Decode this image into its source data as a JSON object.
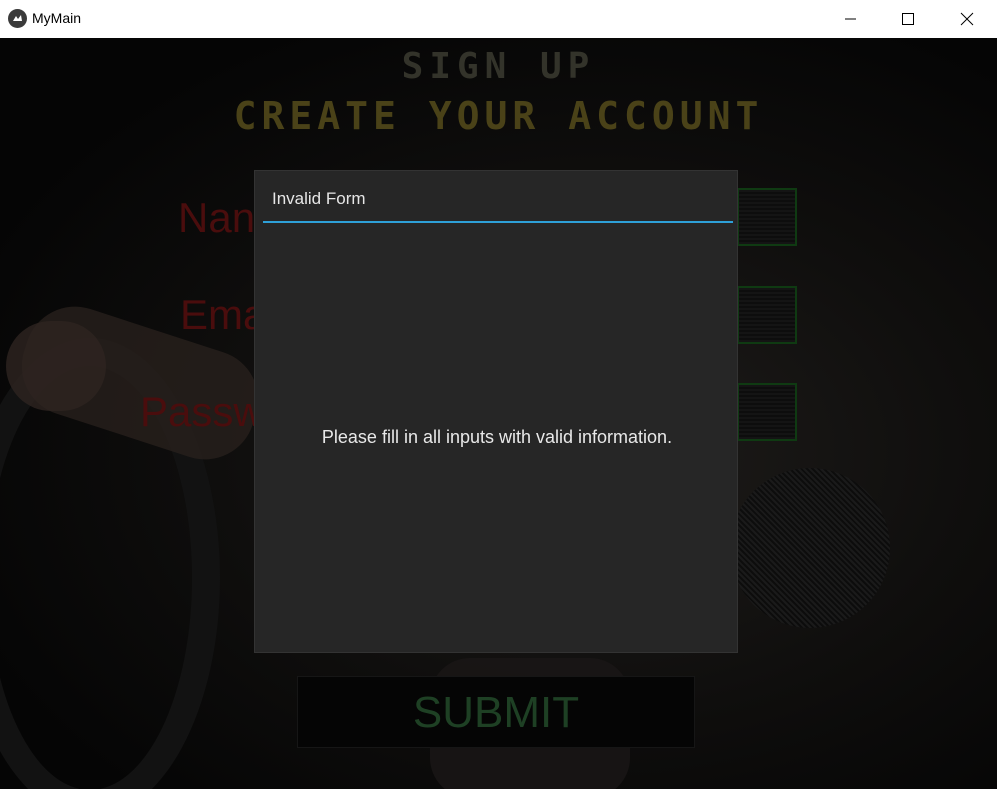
{
  "window": {
    "title": "MyMain",
    "controls": {
      "minimize": "minimize",
      "maximize": "maximize",
      "close": "close"
    }
  },
  "screen": {
    "heading_line1": "SIGN UP",
    "heading_line2": "CREATE YOUR ACCOUNT",
    "fields": {
      "name_label_visible": "Nan",
      "email_label_visible": "Ema",
      "password_label_visible": "Passw"
    },
    "submit_label": "SUBMIT"
  },
  "popup": {
    "title": "Invalid Form",
    "message": "Please fill in all inputs with valid information."
  },
  "colors": {
    "accent": "#2ea0d8",
    "popup_bg": "#262626",
    "label_red": "#4a0d0d",
    "submit_green": "#1e4024"
  }
}
